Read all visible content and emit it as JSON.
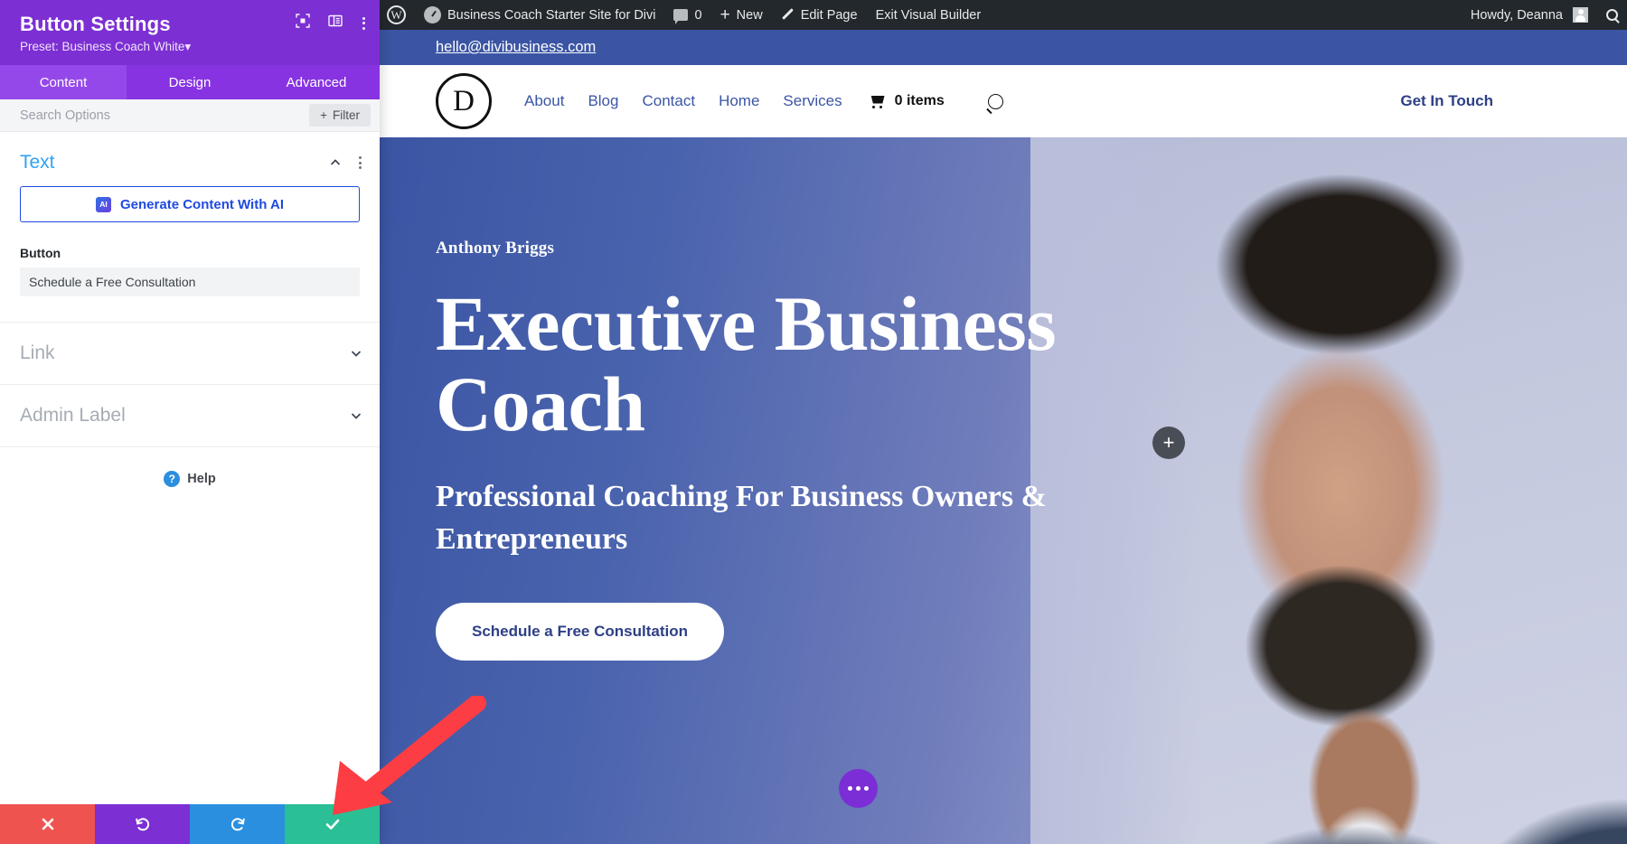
{
  "admin_bar": {
    "wp_logo": "wordpress-logo",
    "site_title": "Business Coach Starter Site for Divi",
    "comment_count": "0",
    "new_label": "New",
    "edit_page_label": "Edit Page",
    "exit_builder_label": "Exit Visual Builder",
    "howdy_label": "Howdy, Deanna",
    "bg_color": "#23282d"
  },
  "panel": {
    "title": "Button Settings",
    "preset": "Preset: Business Coach White",
    "preset_caret": "▾",
    "header_bg": "#7c2fd3",
    "tabs": [
      {
        "label": "Content",
        "active": true
      },
      {
        "label": "Design",
        "active": false
      },
      {
        "label": "Advanced",
        "active": false
      }
    ],
    "search": {
      "placeholder": "Search Options",
      "value": ""
    },
    "filter_label": "Filter",
    "filter_plus": "+",
    "sections": {
      "text": {
        "title": "Text",
        "ai_button_label": "Generate Content With AI",
        "ai_badge": "AI",
        "field_label": "Button",
        "field_value": "Schedule a Free Consultation"
      },
      "link": {
        "title": "Link"
      },
      "admin_label": {
        "title": "Admin Label"
      }
    },
    "help_label": "Help",
    "help_glyph": "?",
    "footer": {
      "cancel": {
        "name": "cancel",
        "color": "#ef5350"
      },
      "undo": {
        "name": "undo",
        "color": "#7c2fd3"
      },
      "redo": {
        "name": "redo",
        "color": "#2b8fe0"
      },
      "save": {
        "name": "save",
        "color": "#2bbf96"
      }
    }
  },
  "site": {
    "topbar": {
      "email": "hello@divibusiness.com",
      "bg_color": "#3b55a4"
    },
    "nav": {
      "logo_letter": "D",
      "links": [
        "About",
        "Blog",
        "Contact",
        "Home",
        "Services"
      ],
      "cart_text": "0 items",
      "cta_label": "Get In Touch",
      "link_color": "#3b55a4"
    },
    "hero": {
      "kicker": "Anthony Briggs",
      "title": "Executive Business Coach",
      "subtitle": "Professional Coaching For Business Owners & Entrepreneurs",
      "button_label": "Schedule a Free Consultation",
      "plus_glyph": "+",
      "gradient_from": "#3b55a4",
      "gradient_to": "#c3c7df"
    }
  },
  "annotation": {
    "arrow_color": "#fc3d43",
    "points_to": "save-button"
  }
}
